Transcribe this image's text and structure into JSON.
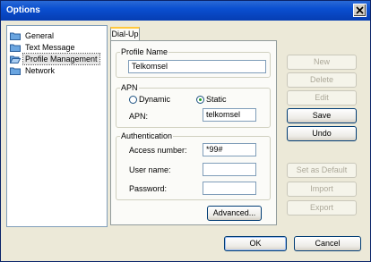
{
  "window": {
    "title": "Options"
  },
  "tree": {
    "items": [
      {
        "label": "General",
        "selected": false
      },
      {
        "label": "Text Message",
        "selected": false
      },
      {
        "label": "Profile Management",
        "selected": true
      },
      {
        "label": "Network",
        "selected": false
      }
    ]
  },
  "tabs": [
    {
      "label": "Dial-Up",
      "active": true
    }
  ],
  "profile_name": {
    "legend": "Profile Name",
    "value": "Telkomsel"
  },
  "apn": {
    "legend": "APN",
    "radio_dynamic": "Dynamic",
    "radio_static": "Static",
    "selected": "Static",
    "apn_label": "APN:",
    "apn_value": "telkomsel"
  },
  "auth": {
    "legend": "Authentication",
    "access_label": "Access number:",
    "access_value": "*99#",
    "user_label": "User name:",
    "user_value": "",
    "password_label": "Password:",
    "password_value": ""
  },
  "buttons": {
    "advanced": "Advanced...",
    "new": "New",
    "delete": "Delete",
    "edit": "Edit",
    "save": "Save",
    "undo": "Undo",
    "set_default": "Set as Default",
    "import": "Import",
    "export": "Export",
    "ok": "OK",
    "cancel": "Cancel"
  }
}
